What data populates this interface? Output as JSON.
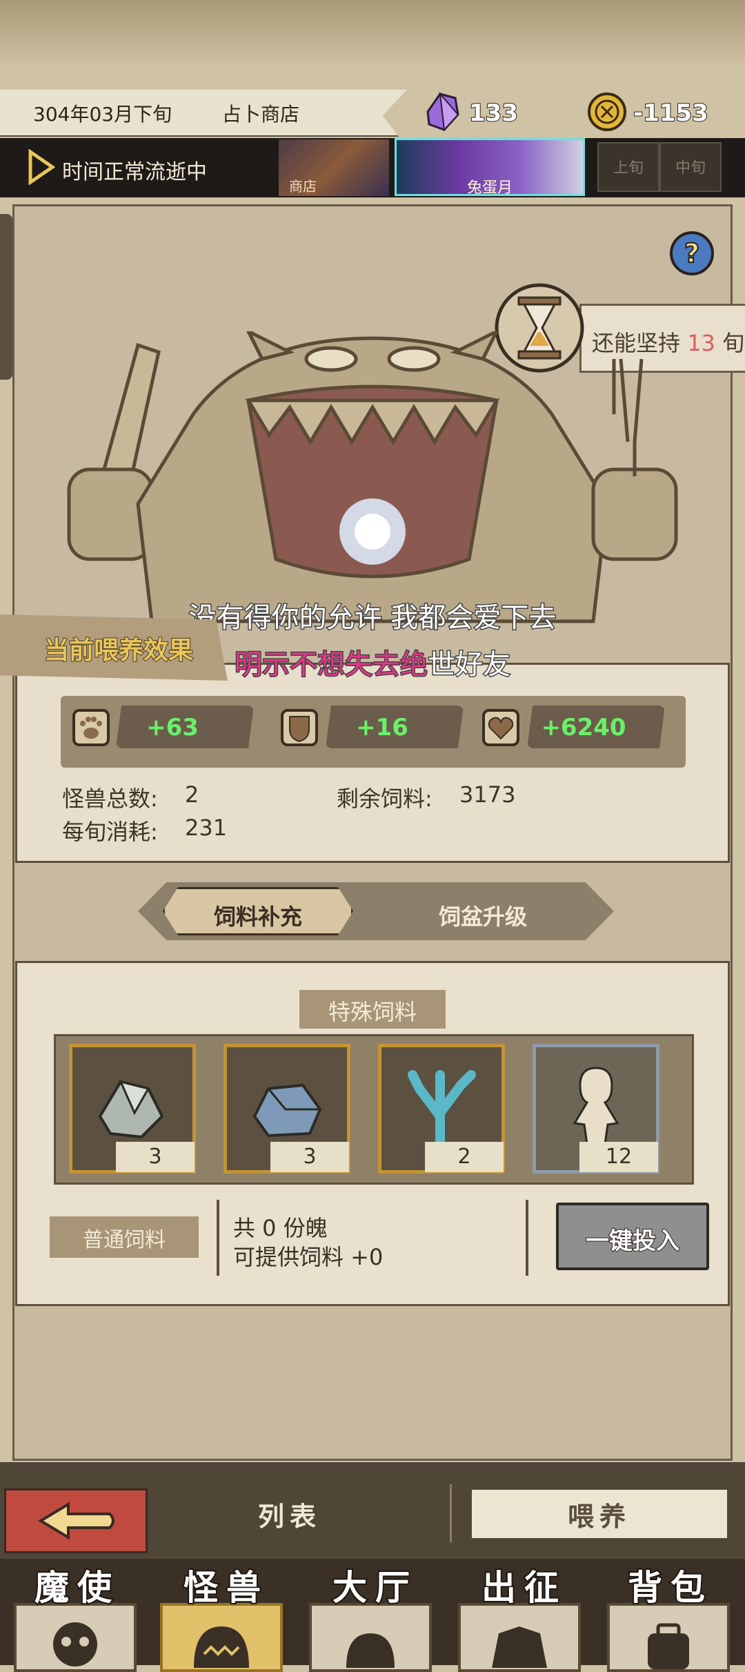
{
  "header": {
    "date": "304年03月下旬",
    "location": "占卜商店",
    "gems": "133",
    "coins": "-1153"
  },
  "timebar": {
    "status": "时间正常流逝中",
    "thumb_shop_label": "商店",
    "thumb_event_label": "兔蛋月",
    "slot1": "上旬",
    "slot2": "中旬"
  },
  "timer": {
    "prefix": "还能坚持",
    "value": "13",
    "suffix": "旬"
  },
  "lyrics": {
    "line1": "没有得你的允许 我都会爱下去",
    "line2_highlight": "明示不想失去绝",
    "line2_rest": "世好友"
  },
  "effect": {
    "title": "当前喂养效果",
    "stats": [
      {
        "icon": "paw-icon",
        "value": "+63"
      },
      {
        "icon": "shield-icon",
        "value": "+16"
      },
      {
        "icon": "heart-icon",
        "value": "+6240"
      }
    ],
    "monster_count_label": "怪兽总数:",
    "monster_count": "2",
    "remaining_feed_label": "剩余饲料:",
    "remaining_feed": "3173",
    "consumption_label": "每旬消耗:",
    "consumption": "231"
  },
  "tabs": {
    "tab1": "饲料补充",
    "tab2": "饲盆升级"
  },
  "special": {
    "title": "特殊饲料",
    "items": [
      {
        "icon": "crystal-ore-icon",
        "count": "3"
      },
      {
        "icon": "blue-stone-icon",
        "count": "3"
      },
      {
        "icon": "coral-icon",
        "count": "2"
      },
      {
        "icon": "soul-silhouette-icon",
        "count": "12"
      }
    ]
  },
  "normal": {
    "label": "普通饲料",
    "soul_text": "共 0 份魄",
    "provide_text": "可提供饲料 +0",
    "oneclick": "一键投入"
  },
  "bottom": {
    "list": "列表",
    "feed": "喂养"
  },
  "nav": [
    {
      "label": "魔使",
      "icon": "skull-icon"
    },
    {
      "label": "怪兽",
      "icon": "monster-icon"
    },
    {
      "label": "大厅",
      "icon": "hall-icon"
    },
    {
      "label": "出征",
      "icon": "demon-face-icon"
    },
    {
      "label": "背包",
      "icon": "bag-icon"
    }
  ]
}
